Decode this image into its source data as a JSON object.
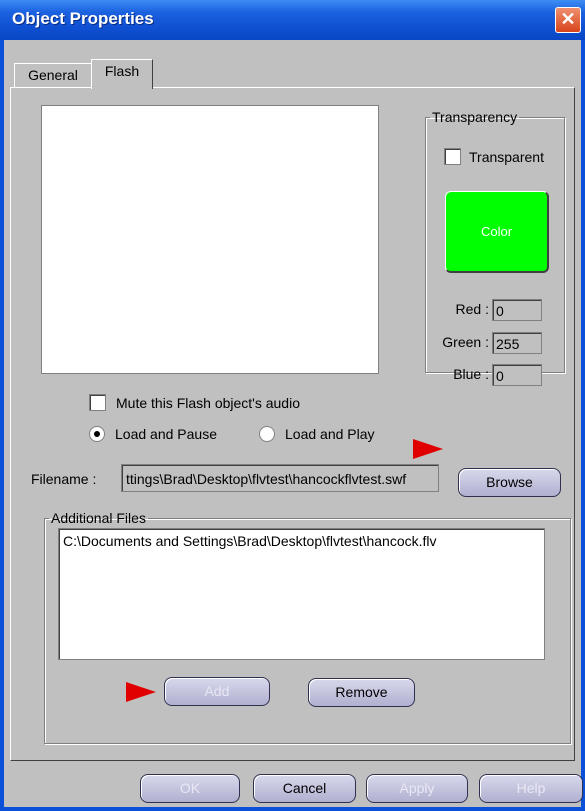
{
  "window": {
    "title": "Object Properties",
    "close_glyph": "✕"
  },
  "tabs": [
    {
      "label": "General"
    },
    {
      "label": "Flash"
    }
  ],
  "transparency": {
    "legend": "Transparency",
    "checkbox_label": "Transparent",
    "checked": false,
    "color_button_label": "Color",
    "color": "#00ff00",
    "red_label": "Red :",
    "red": "0",
    "green_label": "Green :",
    "green": "255",
    "blue_label": "Blue :",
    "blue": "0"
  },
  "options": {
    "mute_label": "Mute this Flash object's audio",
    "load_pause_label": "Load and Pause",
    "load_play_label": "Load and Play",
    "selected": "Load and Pause"
  },
  "filename": {
    "label": "Filename :",
    "value": "ttings\\Brad\\Desktop\\flvtest\\hancockflvtest.swf",
    "browse_label": "Browse"
  },
  "additional_files": {
    "legend": "Additional Files",
    "items": [
      "C:\\Documents and Settings\\Brad\\Desktop\\flvtest\\hancock.flv"
    ],
    "add_label": "Add",
    "remove_label": "Remove"
  },
  "footer": {
    "ok_label": "OK",
    "cancel_label": "Cancel",
    "apply_label": "Apply",
    "help_label": "Help"
  },
  "annotations": {
    "arrow_color": "#e00000"
  }
}
